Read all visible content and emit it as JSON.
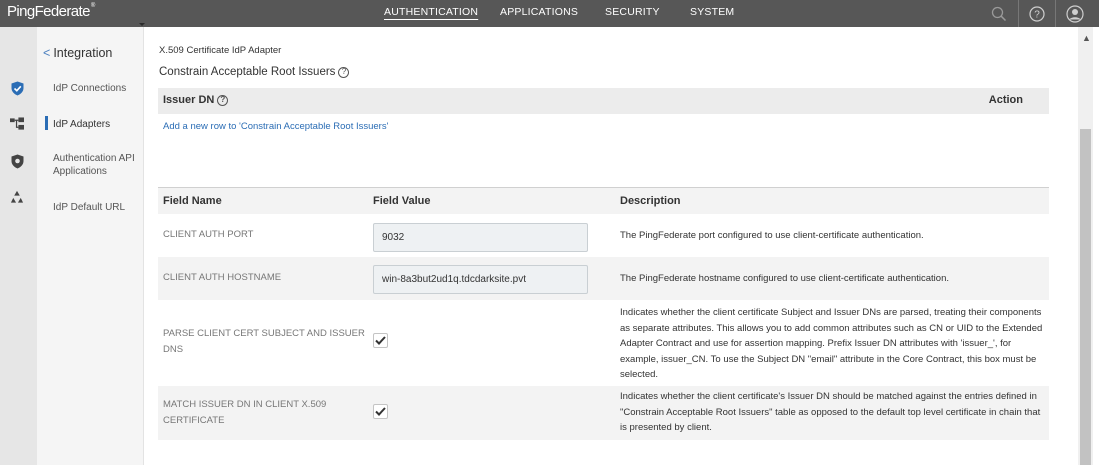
{
  "app": {
    "logo": "PingFederate",
    "logo_mark": "®"
  },
  "topnav": {
    "items": [
      {
        "label": "AUTHENTICATION",
        "active": true
      },
      {
        "label": "APPLICATIONS",
        "active": false
      },
      {
        "label": "SECURITY",
        "active": false
      },
      {
        "label": "SYSTEM",
        "active": false
      }
    ],
    "icons": [
      "search-icon",
      "help-icon",
      "user-icon"
    ],
    "help_glyph": "?"
  },
  "sidebar_icons": [
    "shield-check-icon",
    "connections-icon",
    "shield-icon",
    "recycle-icon"
  ],
  "leftnav": {
    "back_label": "Integration",
    "items": [
      {
        "label": "IdP Connections",
        "active": false
      },
      {
        "label": "IdP Adapters",
        "active": true
      },
      {
        "label": "Authentication API Applications",
        "active": false
      },
      {
        "label": "IdP Default URL",
        "active": false
      }
    ]
  },
  "page": {
    "breadcrumb": "X.509 Certificate IdP Adapter",
    "section_title": "Constrain Acceptable Root Issuers",
    "help_glyph": "?",
    "issuer_table": {
      "col_issuer": "Issuer DN",
      "col_action": "Action",
      "add_row_link": "Add a new row to 'Constrain Acceptable Root Issuers'"
    },
    "fields_table": {
      "headers": [
        "Field Name",
        "Field Value",
        "Description"
      ],
      "rows": [
        {
          "name": "CLIENT AUTH PORT",
          "type": "text",
          "value": "9032",
          "description": "The PingFederate port configured to use client-certificate authentication."
        },
        {
          "name": "CLIENT AUTH HOSTNAME",
          "type": "text",
          "value": "win-8a3but2ud1q.tdcdarksite.pvt",
          "description": "The PingFederate hostname configured to use client-certificate authentication."
        },
        {
          "name": "PARSE CLIENT CERT SUBJECT AND ISSUER DNS",
          "type": "checkbox",
          "checked": true,
          "description": "Indicates whether the client certificate Subject and Issuer DNs are parsed, treating their components as separate attributes. This allows you to add common attributes such as CN or UID to the Extended Adapter Contract and use for assertion mapping. Prefix Issuer DN attributes with 'issuer_', for example, issuer_CN. To use the Subject DN \"email\" attribute in the Core Contract, this box must be selected."
        },
        {
          "name": "MATCH ISSUER DN IN CLIENT X.509 CERTIFICATE",
          "type": "checkbox",
          "checked": true,
          "description": "Indicates whether the client certificate's Issuer DN should be matched against the entries defined in \"Constrain Acceptable Root Issuers\" table as opposed to the default top level certificate in chain that is presented by client."
        }
      ]
    }
  },
  "colors": {
    "topbar": "#575757",
    "link": "#2b6db5",
    "accent": "#2b6db5"
  }
}
